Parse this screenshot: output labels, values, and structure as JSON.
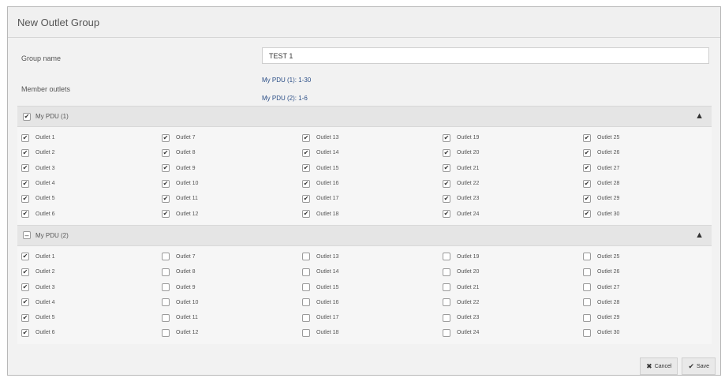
{
  "dialog": {
    "title": "New Outlet Group"
  },
  "form": {
    "group_name_label": "Group name",
    "group_name_value": "TEST 1",
    "member_label": "Member outlets",
    "member_links": [
      "My PDU (1): 1-30",
      "My PDU (2): 1-6"
    ]
  },
  "groups": [
    {
      "name": "My PDU (1)",
      "state": "checked",
      "outlets": [
        {
          "label": "Outlet 1",
          "checked": true
        },
        {
          "label": "Outlet 7",
          "checked": true
        },
        {
          "label": "Outlet 13",
          "checked": true
        },
        {
          "label": "Outlet 19",
          "checked": true
        },
        {
          "label": "Outlet 25",
          "checked": true
        },
        {
          "label": "Outlet 2",
          "checked": true
        },
        {
          "label": "Outlet 8",
          "checked": true
        },
        {
          "label": "Outlet 14",
          "checked": true
        },
        {
          "label": "Outlet 20",
          "checked": true
        },
        {
          "label": "Outlet 26",
          "checked": true
        },
        {
          "label": "Outlet 3",
          "checked": true
        },
        {
          "label": "Outlet 9",
          "checked": true
        },
        {
          "label": "Outlet 15",
          "checked": true
        },
        {
          "label": "Outlet 21",
          "checked": true
        },
        {
          "label": "Outlet 27",
          "checked": true
        },
        {
          "label": "Outlet 4",
          "checked": true
        },
        {
          "label": "Outlet 10",
          "checked": true
        },
        {
          "label": "Outlet 16",
          "checked": true
        },
        {
          "label": "Outlet 22",
          "checked": true
        },
        {
          "label": "Outlet 28",
          "checked": true
        },
        {
          "label": "Outlet 5",
          "checked": true
        },
        {
          "label": "Outlet 11",
          "checked": true
        },
        {
          "label": "Outlet 17",
          "checked": true
        },
        {
          "label": "Outlet 23",
          "checked": true
        },
        {
          "label": "Outlet 29",
          "checked": true
        },
        {
          "label": "Outlet 6",
          "checked": true
        },
        {
          "label": "Outlet 12",
          "checked": true
        },
        {
          "label": "Outlet 18",
          "checked": true
        },
        {
          "label": "Outlet 24",
          "checked": true
        },
        {
          "label": "Outlet 30",
          "checked": true
        }
      ]
    },
    {
      "name": "My PDU (2)",
      "state": "partial",
      "outlets": [
        {
          "label": "Outlet 1",
          "checked": true
        },
        {
          "label": "Outlet 7",
          "checked": false
        },
        {
          "label": "Outlet 13",
          "checked": false
        },
        {
          "label": "Outlet 19",
          "checked": false
        },
        {
          "label": "Outlet 25",
          "checked": false
        },
        {
          "label": "Outlet 2",
          "checked": true
        },
        {
          "label": "Outlet 8",
          "checked": false
        },
        {
          "label": "Outlet 14",
          "checked": false
        },
        {
          "label": "Outlet 20",
          "checked": false
        },
        {
          "label": "Outlet 26",
          "checked": false
        },
        {
          "label": "Outlet 3",
          "checked": true
        },
        {
          "label": "Outlet 9",
          "checked": false
        },
        {
          "label": "Outlet 15",
          "checked": false
        },
        {
          "label": "Outlet 21",
          "checked": false
        },
        {
          "label": "Outlet 27",
          "checked": false
        },
        {
          "label": "Outlet 4",
          "checked": true
        },
        {
          "label": "Outlet 10",
          "checked": false
        },
        {
          "label": "Outlet 16",
          "checked": false
        },
        {
          "label": "Outlet 22",
          "checked": false
        },
        {
          "label": "Outlet 28",
          "checked": false
        },
        {
          "label": "Outlet 5",
          "checked": true
        },
        {
          "label": "Outlet 11",
          "checked": false
        },
        {
          "label": "Outlet 17",
          "checked": false
        },
        {
          "label": "Outlet 23",
          "checked": false
        },
        {
          "label": "Outlet 29",
          "checked": false
        },
        {
          "label": "Outlet 6",
          "checked": true
        },
        {
          "label": "Outlet 12",
          "checked": false
        },
        {
          "label": "Outlet 18",
          "checked": false
        },
        {
          "label": "Outlet 24",
          "checked": false
        },
        {
          "label": "Outlet 30",
          "checked": false
        }
      ]
    }
  ],
  "footer": {
    "cancel_label": "Cancel",
    "save_label": "Save",
    "cancel_icon": "close-icon",
    "save_icon": "checkmark-icon"
  }
}
